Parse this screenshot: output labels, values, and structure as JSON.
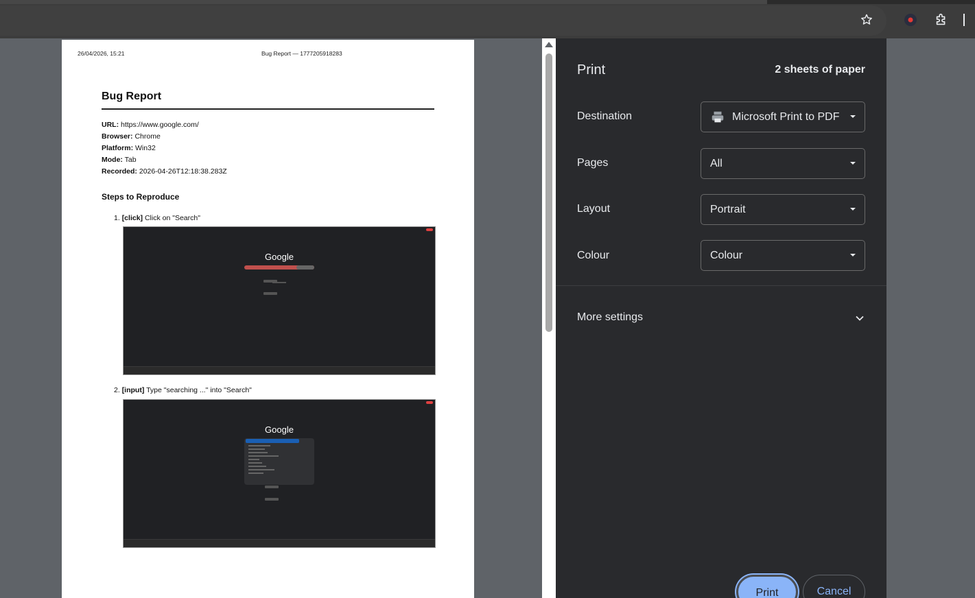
{
  "document": {
    "header_date": "26/04/2026, 15:21",
    "header_title": "Bug Report — 1777205918283",
    "title": "Bug Report",
    "meta": [
      {
        "label": "URL:",
        "value": "https://www.google.com/"
      },
      {
        "label": "Browser:",
        "value": "Chrome"
      },
      {
        "label": "Platform:",
        "value": "Win32"
      },
      {
        "label": "Mode:",
        "value": "Tab"
      },
      {
        "label": "Recorded:",
        "value": "2026-04-26T12:18:38.283Z"
      }
    ],
    "steps_heading": "Steps to Reproduce",
    "steps": [
      {
        "num": "1.",
        "action": "[click]",
        "text": "Click on \"Search\"",
        "screenshot_logo": "Google"
      },
      {
        "num": "2.",
        "action": "[input]",
        "text": "Type \"searching ...\" into \"Search\"",
        "screenshot_logo": "Google"
      }
    ]
  },
  "print_panel": {
    "title": "Print",
    "sheets": "2 sheets of paper",
    "rows": [
      {
        "label": "Destination",
        "value": "Microsoft Print to PDF"
      },
      {
        "label": "Pages",
        "value": "All"
      },
      {
        "label": "Layout",
        "value": "Portrait"
      },
      {
        "label": "Colour",
        "value": "Colour"
      }
    ],
    "more_settings": "More settings",
    "print_label": "Print",
    "cancel_label": "Cancel"
  },
  "colors": {
    "accent": "#8ab4f8",
    "panel_bg": "#292a2d",
    "preview_bg": "#5f6368"
  },
  "icons": {
    "bookmark": "star-icon",
    "recorder": "record-icon",
    "extensions": "puzzle-icon",
    "printer": "printer-icon",
    "expand": "chevron-down-icon"
  }
}
